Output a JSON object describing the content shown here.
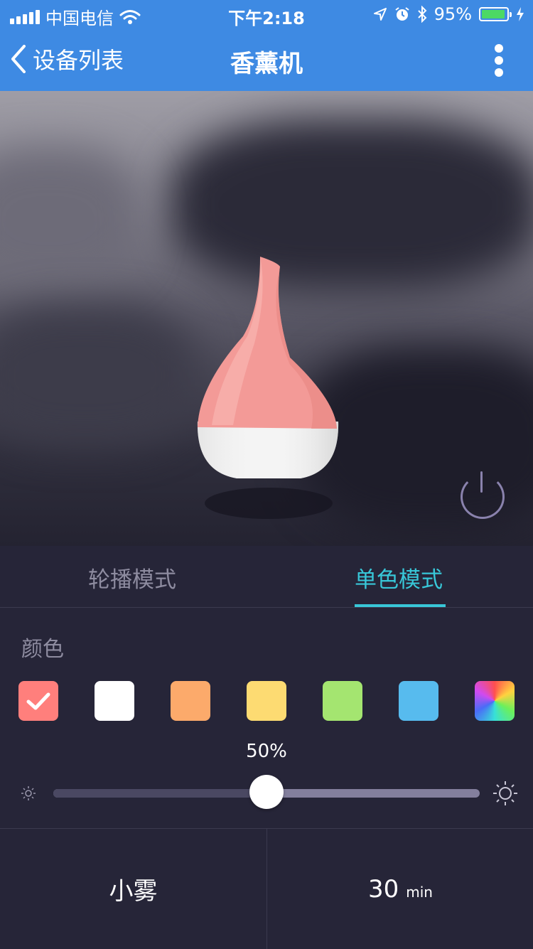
{
  "status_bar": {
    "carrier": "中国电信",
    "time": "下午2:18",
    "battery_percent": "95%",
    "battery_level": 0.95
  },
  "nav": {
    "back_label": "设备列表",
    "title": "香薰机"
  },
  "tabs": [
    {
      "label": "轮播模式",
      "active": false
    },
    {
      "label": "单色模式",
      "active": true
    }
  ],
  "color_section": {
    "label": "颜色",
    "swatches": [
      {
        "color": "#ff7f7c",
        "selected": true
      },
      {
        "color": "#ffffff",
        "selected": false
      },
      {
        "color": "#fcaa6b",
        "selected": false
      },
      {
        "color": "#fddb72",
        "selected": false
      },
      {
        "color": "#a4e570",
        "selected": false
      },
      {
        "color": "#57bbee",
        "selected": false
      },
      {
        "color": "rainbow",
        "selected": false
      }
    ]
  },
  "brightness": {
    "value_label": "50%",
    "value": 0.5
  },
  "bottom": {
    "mist_label": "小雾",
    "timer_value": "30",
    "timer_unit": "min"
  },
  "colors": {
    "header": "#3e8ae3",
    "accent": "#38c7d8",
    "panel": "#262538"
  }
}
